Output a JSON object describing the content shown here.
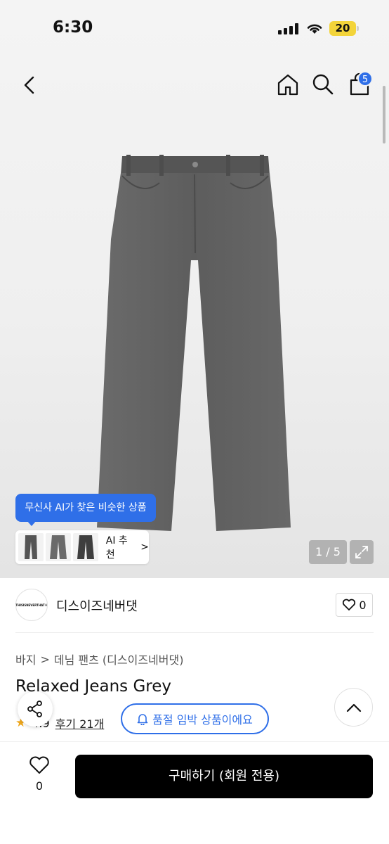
{
  "status_bar": {
    "time": "6:30",
    "battery": "20"
  },
  "nav": {
    "cart_count": "5"
  },
  "gallery": {
    "ai_tooltip": "무신사 AI가 찾은 비슷한 상품",
    "ai_button_label": "AI 추천",
    "ai_chevron": ">",
    "pager": "1 / 5"
  },
  "brand": {
    "logo_text": "THISISNEVERTHAT®",
    "name": "디스이즈네버댓",
    "like_count": "0"
  },
  "breadcrumb": {
    "category": "바지",
    "separator": ">",
    "subcategory": "데님 팬츠 (디스이즈네버댓)"
  },
  "product": {
    "title": "Relaxed Jeans Grey"
  },
  "rating": {
    "score": "4.9",
    "review_label": "후기 21개"
  },
  "stock_pill": {
    "label": "품절 임박 상품이에요"
  },
  "bottom": {
    "wish_count": "0",
    "buy_label": "구매하기 (회원 전용)"
  },
  "colors": {
    "accent": "#2f6fe8",
    "battery": "#f3d43a",
    "star": "#f0a81c",
    "denim": "#5f5f5f"
  }
}
